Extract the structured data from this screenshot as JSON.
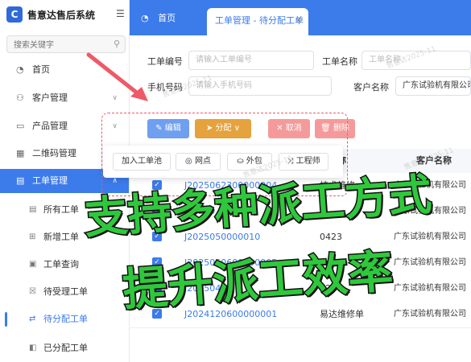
{
  "app": {
    "title": "售意达售后系统",
    "logo_char": "C"
  },
  "search": {
    "placeholder": "搜索关键字"
  },
  "nav": [
    {
      "label": "首页",
      "icon": "dashboard-icon",
      "glyph": "◔"
    },
    {
      "label": "客户管理",
      "icon": "user-icon",
      "glyph": "⚇",
      "chevron": "∨"
    },
    {
      "label": "产品管理",
      "icon": "box-icon",
      "glyph": "▭",
      "chevron": "∨"
    },
    {
      "label": "二维码管理",
      "icon": "qrcode-icon",
      "glyph": "▦"
    },
    {
      "label": "工单管理",
      "icon": "document-icon",
      "glyph": "▤",
      "chevron": "∧"
    }
  ],
  "subnav": [
    {
      "label": "所有工单",
      "icon": "list-icon",
      "glyph": "▤"
    },
    {
      "label": "新增工单",
      "icon": "add-doc-icon",
      "glyph": "⊞"
    },
    {
      "label": "工单查询",
      "icon": "search-doc-icon",
      "glyph": "▣"
    },
    {
      "label": "待受理工单",
      "icon": "pending-icon",
      "glyph": "☒"
    },
    {
      "label": "待分配工单",
      "icon": "assign-icon",
      "glyph": "⇄"
    },
    {
      "label": "已分配工单",
      "icon": "assigned-icon",
      "glyph": "◧"
    }
  ],
  "tabs": {
    "home": "首页",
    "home_glyph": "◔",
    "active": "工单管理 - 待分配工单",
    "close": "×"
  },
  "filters": {
    "order_no_label": "工单编号",
    "order_no_placeholder": "请输入工单编号",
    "order_name_label": "工单名称",
    "order_name_placeholder": "工单名称",
    "phone_label": "手机号码",
    "phone_placeholder": "请输入手机号码",
    "customer_label": "客户名称",
    "customer_value": "广东试验机有限公司"
  },
  "toolbar": {
    "edit": "✎ 编辑",
    "assign": "➤ 分配 ∨",
    "cancel": "✕ 取消",
    "delete": "🗑 删除"
  },
  "assign_menu": [
    {
      "label": "加入工单池"
    },
    {
      "label": "◎ 网点"
    },
    {
      "label": "⛀ 外包"
    },
    {
      "label": "⤨ 工程师"
    }
  ],
  "table": {
    "header_name_fragment": "称",
    "header_customer": "客户名称",
    "rows": [
      {
        "no": "J2025062300000004",
        "name": "技术维修",
        "customer": "广东试验机有限公司"
      },
      {
        "no": "J20250",
        "name": "",
        "customer": "广东试验机有限公司"
      },
      {
        "no": "J2025050000010",
        "name": "0423",
        "customer": "广东试验机有限公司"
      },
      {
        "no": "J2025050600000005",
        "name": "",
        "customer": "广东试验机有限公司"
      },
      {
        "no": "J202504",
        "name": "1206",
        "customer": "广东试验机有限公司"
      },
      {
        "no": "J2024120600000001",
        "name": "易达维修单",
        "customer": "广东试验机有限公司"
      }
    ]
  },
  "watermark": "售意达2025-11",
  "promo": {
    "line1": "支持多种派工方式",
    "line2": "提升派工效率"
  },
  "colors": {
    "primary": "#3c7bea",
    "warning": "#e6a23c",
    "danger": "#f59a9a",
    "promo_green": "#2fc83c"
  }
}
